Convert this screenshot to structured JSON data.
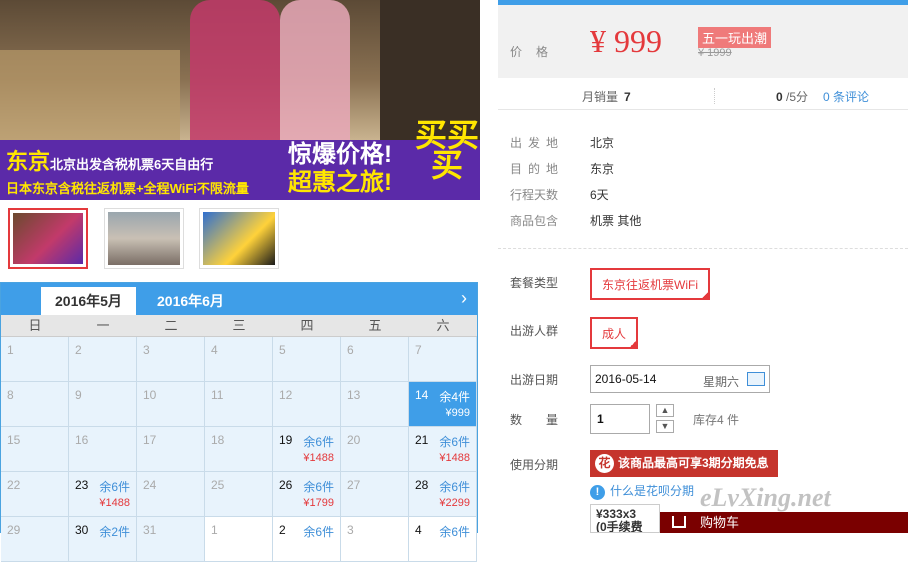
{
  "banner": {
    "city": "东京",
    "headline": "北京出发含税机票6天自由行",
    "subline": "日本东京含税往返机票+全程WiFi不限流量",
    "promo_top": "惊爆价格!",
    "promo_bottom": "超惠之旅!",
    "buy": "买买买"
  },
  "thumbnails": [
    {
      "name": "thumb-1",
      "active": true
    },
    {
      "name": "thumb-2",
      "active": false
    },
    {
      "name": "thumb-3",
      "active": false
    }
  ],
  "calendar": {
    "months": [
      "2016年5月",
      "2016年6月"
    ],
    "next_icon": "chevron-right-icon",
    "weekdays": [
      "日",
      "一",
      "二",
      "三",
      "四",
      "五",
      "六"
    ],
    "rows": [
      [
        {
          "d": "1"
        },
        {
          "d": "2"
        },
        {
          "d": "3"
        },
        {
          "d": "4"
        },
        {
          "d": "5"
        },
        {
          "d": "6"
        },
        {
          "d": "7"
        }
      ],
      [
        {
          "d": "8"
        },
        {
          "d": "9"
        },
        {
          "d": "10"
        },
        {
          "d": "11"
        },
        {
          "d": "12"
        },
        {
          "d": "13"
        },
        {
          "d": "14",
          "stock": "余4件",
          "price": "¥999",
          "selected": true
        }
      ],
      [
        {
          "d": "15"
        },
        {
          "d": "16"
        },
        {
          "d": "17"
        },
        {
          "d": "18"
        },
        {
          "d": "19",
          "stock": "余6件",
          "price": "¥1488"
        },
        {
          "d": "20"
        },
        {
          "d": "21",
          "stock": "余6件",
          "price": "¥1488"
        }
      ],
      [
        {
          "d": "22"
        },
        {
          "d": "23",
          "stock": "余6件",
          "price": "¥1488"
        },
        {
          "d": "24"
        },
        {
          "d": "25"
        },
        {
          "d": "26",
          "stock": "余6件",
          "price": "¥1799"
        },
        {
          "d": "27"
        },
        {
          "d": "28",
          "stock": "余6件",
          "price": "¥2299"
        }
      ],
      [
        {
          "d": "29"
        },
        {
          "d": "30",
          "stock": "余2件"
        },
        {
          "d": "31"
        },
        {
          "d": "1",
          "white": true
        },
        {
          "d": "2",
          "stock": "余6件",
          "white": true
        },
        {
          "d": "3",
          "white": true
        },
        {
          "d": "4",
          "stock": "余6件",
          "white": true
        }
      ]
    ]
  },
  "price": {
    "label": "价格",
    "value": "¥ 999",
    "badge": "五一玩出潮",
    "original": "¥ 1999"
  },
  "stats": {
    "sales_label": "月销量",
    "sales_value": "7",
    "score_value": "0",
    "score_suffix": "/5分",
    "reviews": "0 条评论"
  },
  "info": {
    "from_label": "出发地",
    "from_value": "北京",
    "to_label": "目的地",
    "to_value": "东京",
    "days_label": "行程天数",
    "days_value": "6天",
    "includes_label": "商品包含",
    "includes_value": "机票  其他"
  },
  "options": {
    "package_label": "套餐类型",
    "package_value": "东京往返机票WiFi",
    "group_label": "出游人群",
    "group_value": "成人",
    "date_label": "出游日期",
    "date_value": "2016-05-14",
    "date_weekday": "星期六",
    "qty_label": "数量",
    "qty_value": "1",
    "stock_text": "库存4 件",
    "installment_label": "使用分期",
    "installment_text": "该商品最高可享3期分期免息",
    "help_text": "什么是花呗分期",
    "plan_line1": "¥333x3",
    "plan_line2": "(0手续费",
    "cart": "购物车"
  },
  "watermark": "eLvXing.net",
  "colors": {
    "accent": "#3f9ee8",
    "price": "#e4393c",
    "promo": "#5b2aa8"
  }
}
